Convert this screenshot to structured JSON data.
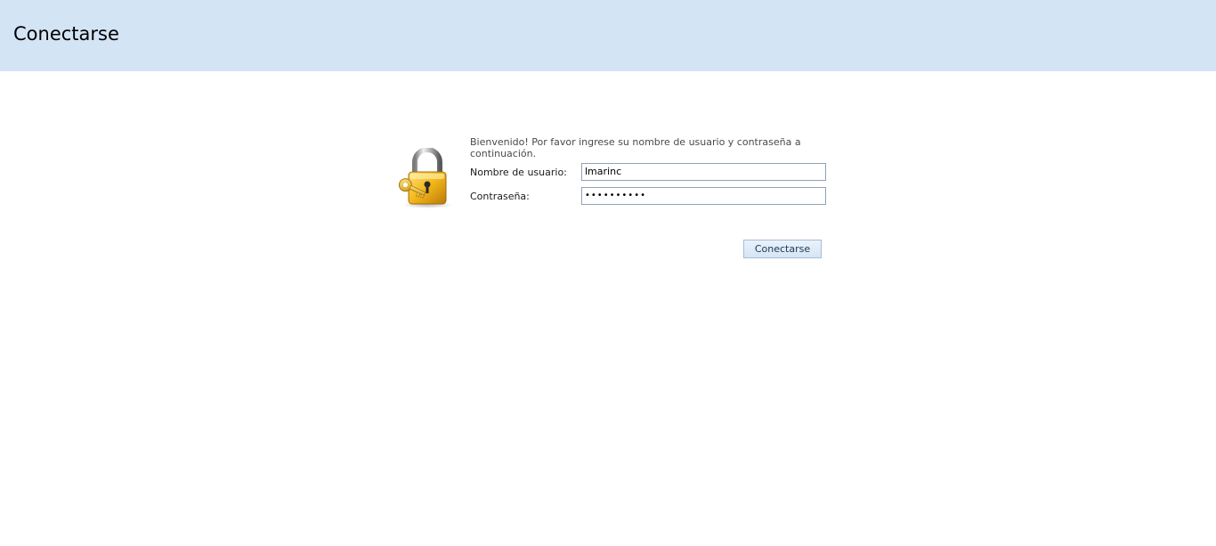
{
  "header": {
    "title": "Conectarse",
    "background_color": "#d3e4f5"
  },
  "login": {
    "icon": "lock-with-key-icon",
    "welcome_text": "Bienvenido! Por favor ingrese su nombre de usuario y contraseña a continuación.",
    "username_label": "Nombre de usuario:",
    "username_value": "lmarinc",
    "password_label": "Contraseña:",
    "password_value": "••••••••••",
    "submit_label": "Conectarse"
  }
}
